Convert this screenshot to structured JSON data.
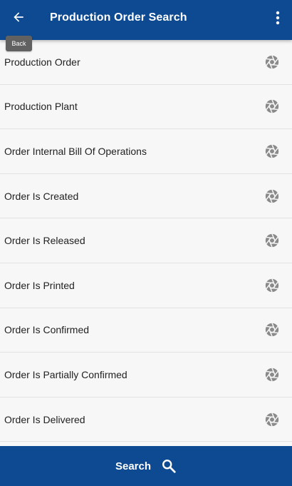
{
  "header": {
    "title": "Production Order Search",
    "back_tooltip": "Back",
    "back_icon": "arrow-left-icon",
    "menu_icon": "more-vertical-icon"
  },
  "list": {
    "items": [
      {
        "label": "Production Order",
        "icon": "shutter-icon"
      },
      {
        "label": "Production Plant",
        "icon": "shutter-icon"
      },
      {
        "label": "Order Internal Bill Of Operations",
        "icon": "shutter-icon"
      },
      {
        "label": "Order Is Created",
        "icon": "shutter-icon"
      },
      {
        "label": "Order Is Released",
        "icon": "shutter-icon"
      },
      {
        "label": "Order Is Printed",
        "icon": "shutter-icon"
      },
      {
        "label": "Order Is Confirmed",
        "icon": "shutter-icon"
      },
      {
        "label": "Order Is Partially Confirmed",
        "icon": "shutter-icon"
      },
      {
        "label": "Order Is Delivered",
        "icon": "shutter-icon"
      }
    ]
  },
  "footer": {
    "search_label": "Search",
    "search_icon": "search-icon"
  },
  "colors": {
    "primary": "#0d4a91",
    "tooltip_bg": "#616161",
    "icon_gray": "#8a8a8a",
    "background": "#f7f7f7"
  }
}
